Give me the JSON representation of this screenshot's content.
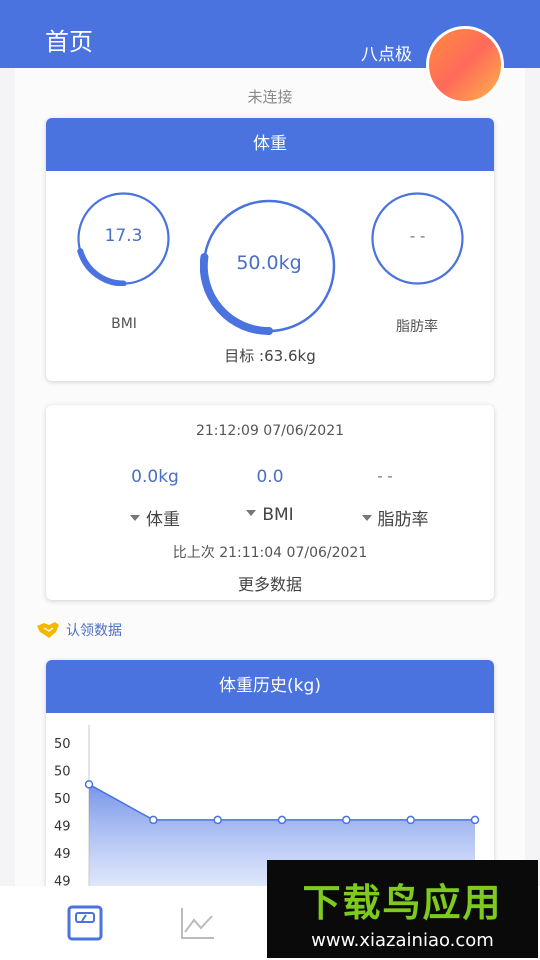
{
  "header": {
    "title": "首页",
    "username": "八点极"
  },
  "connection_status": "未连接",
  "weight_card": {
    "title": "体重",
    "bmi": {
      "value": "17.3",
      "label": "BMI"
    },
    "weight": {
      "value": "50.0kg"
    },
    "fat": {
      "value": "- -",
      "label": "脂肪率"
    },
    "target": "目标 :63.6kg"
  },
  "record_card": {
    "timestamp": "21:12:09  07/06/2021",
    "weight_value": "0.0kg",
    "bmi_value": "0.0",
    "fat_value": "- -",
    "weight_label": "体重",
    "bmi_label": "BMI",
    "fat_label": "脂肪率",
    "previous": "比上次  21:11:04  07/06/2021",
    "more": "更多数据"
  },
  "claim_label": "认领数据",
  "history_card": {
    "title": "体重历史(kg)",
    "y_ticks": [
      "50",
      "50",
      "50",
      "49",
      "49",
      "49"
    ]
  },
  "chart_data": {
    "type": "area",
    "title": "体重历史(kg)",
    "y_tick_labels": [
      "50",
      "50",
      "50",
      "49",
      "49",
      "49"
    ],
    "x": [
      1,
      2,
      3,
      4,
      5,
      6,
      7
    ],
    "values": [
      49.9,
      49.6,
      49.6,
      49.6,
      49.6,
      49.6,
      49.6
    ],
    "ylim": [
      48.9,
      50.4
    ],
    "line_color": "#4a73e0"
  },
  "watermark": {
    "text": "下载鸟应用",
    "url": "www.xiazainiao.com"
  },
  "colors": {
    "primary": "#4a73e0",
    "value_text": "#4a6fc4",
    "watermark_green": "#7ecb1e"
  },
  "nav": {
    "items": [
      "scale-icon",
      "chart-icon"
    ]
  }
}
